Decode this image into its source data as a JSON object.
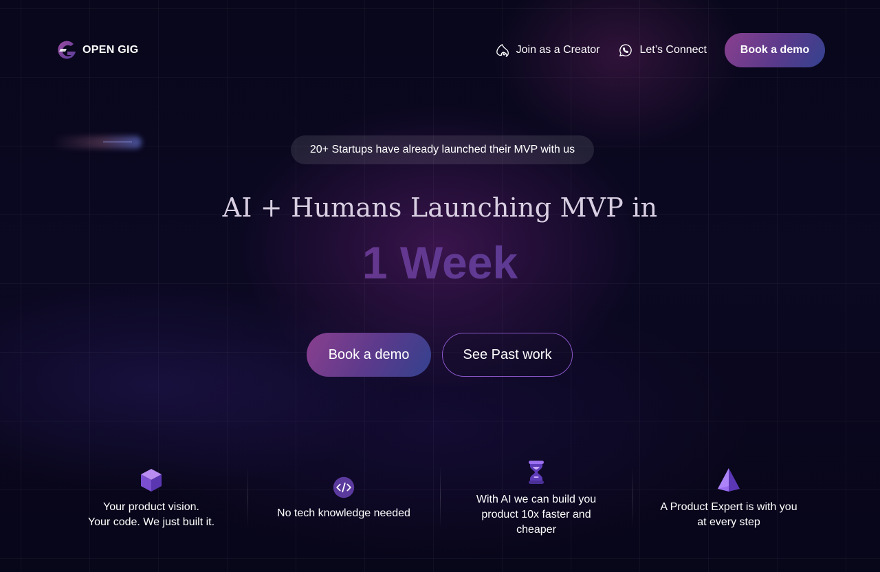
{
  "header": {
    "logo_text": "OPEN GIG",
    "nav": {
      "join_creator": "Join as a Creator",
      "connect": "Let’s Connect",
      "book_demo": "Book a demo"
    }
  },
  "hero": {
    "badge": "20+ Startups have already launched their MVP with us",
    "title": "AI + Humans Launching MVP in",
    "accent": "1 Week",
    "primary_cta": "Book a demo",
    "secondary_cta": "See Past work"
  },
  "features": [
    {
      "icon": "cube-icon",
      "text": "Your product vision.\nYour code. We just built it."
    },
    {
      "icon": "code-icon",
      "text": "No tech knowledge needed"
    },
    {
      "icon": "hourglass-icon",
      "text": "With AI we can build you product 10x faster and cheaper"
    },
    {
      "icon": "pyramid-icon",
      "text": "A  Product Expert is with you at every step"
    }
  ],
  "colors": {
    "background": "#07061a",
    "accent_pink": "#8a3f8e",
    "accent_violet": "#5a3a8c",
    "accent_blue": "#33428e",
    "outline": "#8a56c8"
  }
}
